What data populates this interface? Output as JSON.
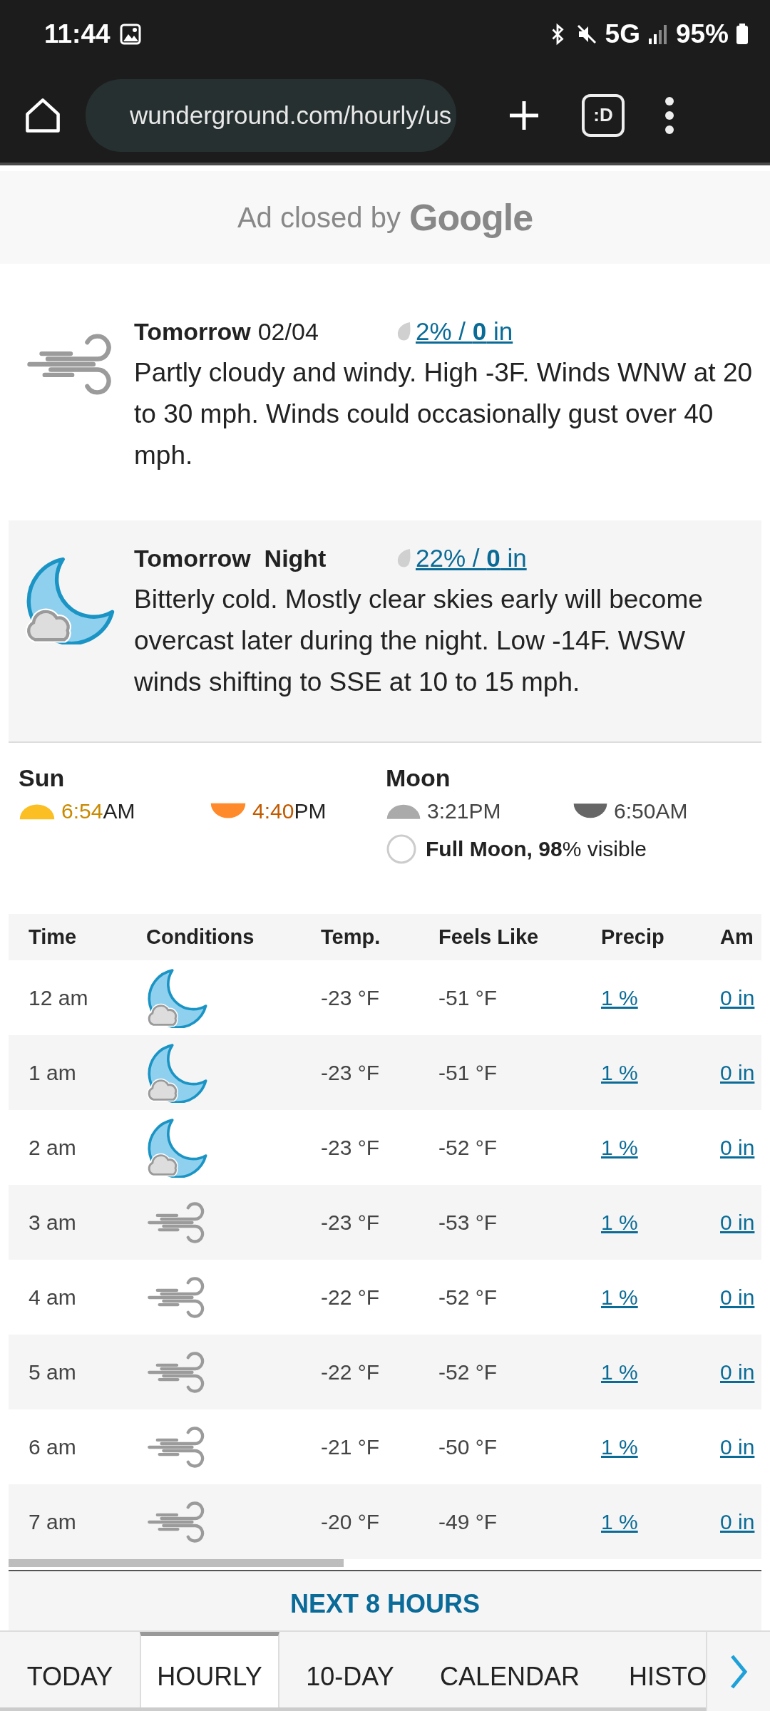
{
  "status_bar": {
    "time": "11:44",
    "network": "5G",
    "battery": "95%"
  },
  "browser": {
    "url": "wunderground.com/hourly/us",
    "tab_switcher_label": ":D"
  },
  "ad_notice": {
    "text": "Ad closed by",
    "brand": "Google"
  },
  "forecast": [
    {
      "kind": "windy",
      "title": "Tomorrow",
      "date": "02/04",
      "precip": "2% / **0** in",
      "description": "Partly cloudy and windy. High -3F. Winds WNW at 20 to 30 mph. Winds could occasionally gust over 40 mph."
    },
    {
      "kind": "night-cloudy",
      "title": "Tomorrow  Night",
      "precip": "22% / **0** in",
      "description": "Bitterly cold. Mostly clear skies early will become overcast later during the night. Low -14F. WSW winds shifting to SSE at 10 to 15 mph."
    }
  ],
  "sun": {
    "label": "Sun",
    "rise_time": "6:54",
    "rise_suffix": "AM",
    "set_time": "4:40",
    "set_suffix": "PM"
  },
  "moon": {
    "label": "Moon",
    "rise": "3:21PM",
    "set": "6:50AM",
    "phase": "**Full Moon, 98**% visible"
  },
  "table": {
    "columns": [
      "Time",
      "Conditions",
      "Temp.",
      "Feels Like",
      "Precip",
      "Am"
    ],
    "rows": [
      {
        "time": "12 am",
        "kind": "night-cloudy",
        "temp": "-23 °F",
        "feels_like": "-51 °F",
        "precip": "1 %",
        "amount": "0 in"
      },
      {
        "time": "1 am",
        "kind": "night-cloudy",
        "temp": "-23 °F",
        "feels_like": "-51 °F",
        "precip": "1 %",
        "amount": "0 in"
      },
      {
        "time": "2 am",
        "kind": "night-cloudy",
        "temp": "-23 °F",
        "feels_like": "-52 °F",
        "precip": "1 %",
        "amount": "0 in"
      },
      {
        "time": "3 am",
        "kind": "windy",
        "temp": "-23 °F",
        "feels_like": "-53 °F",
        "precip": "1 %",
        "amount": "0 in"
      },
      {
        "time": "4 am",
        "kind": "windy",
        "temp": "-22 °F",
        "feels_like": "-52 °F",
        "precip": "1 %",
        "amount": "0 in"
      },
      {
        "time": "5 am",
        "kind": "windy",
        "temp": "-22 °F",
        "feels_like": "-52 °F",
        "precip": "1 %",
        "amount": "0 in"
      },
      {
        "time": "6 am",
        "kind": "windy",
        "temp": "-21 °F",
        "feels_like": "-50 °F",
        "precip": "1 %",
        "amount": "0 in"
      },
      {
        "time": "7 am",
        "kind": "windy",
        "temp": "-20 °F",
        "feels_like": "-49 °F",
        "precip": "1 %",
        "amount": "0 in"
      }
    ]
  },
  "next_button": "NEXT 8 HOURS",
  "tabs": [
    {
      "label": "TODAY",
      "selected": false
    },
    {
      "label": "HOURLY",
      "selected": true
    },
    {
      "label": "10-DAY",
      "selected": false
    },
    {
      "label": "CALENDAR",
      "selected": false
    },
    {
      "label": "HISTO",
      "selected": false
    }
  ]
}
